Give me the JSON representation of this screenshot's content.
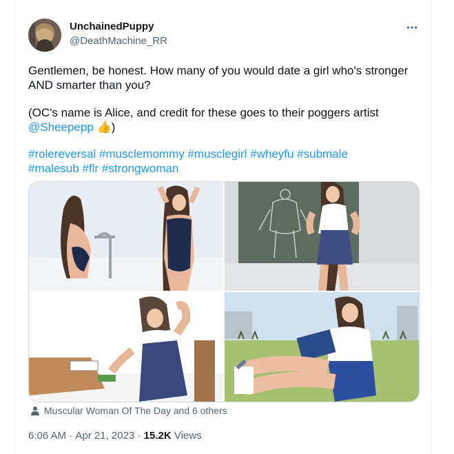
{
  "author": {
    "display_name": "UnchainedPuppy",
    "handle": "@DeathMachine_RR"
  },
  "tweet": {
    "line1": "Gentlemen, be honest. How many of you would date a girl who's stronger",
    "line2": "AND smarter than you?",
    "line3": "(OC's name is Alice, and credit for these goes to their poggers artist",
    "mention": "@Sheepepp",
    "emoji": "👍",
    "close_paren": ")",
    "hashtags_line1": "#rolereversal #musclemommy #musclegirl #wheyfu #submale",
    "hashtags_line2": "#malesub #flr #strongwoman"
  },
  "tagged": {
    "text": "Muscular Woman Of The Day and 6 others"
  },
  "meta": {
    "time": "6:06 AM",
    "separator": " · ",
    "date": "Apr 21, 2023",
    "separator2": " · ",
    "views_count": "15.2K",
    "views_label": " Views"
  },
  "icons": {
    "more": "more-dots-icon",
    "tagged": "person-icon"
  },
  "colors": {
    "link": "#1d9bf0",
    "secondary_text": "#536471",
    "border": "#cfd9de"
  }
}
